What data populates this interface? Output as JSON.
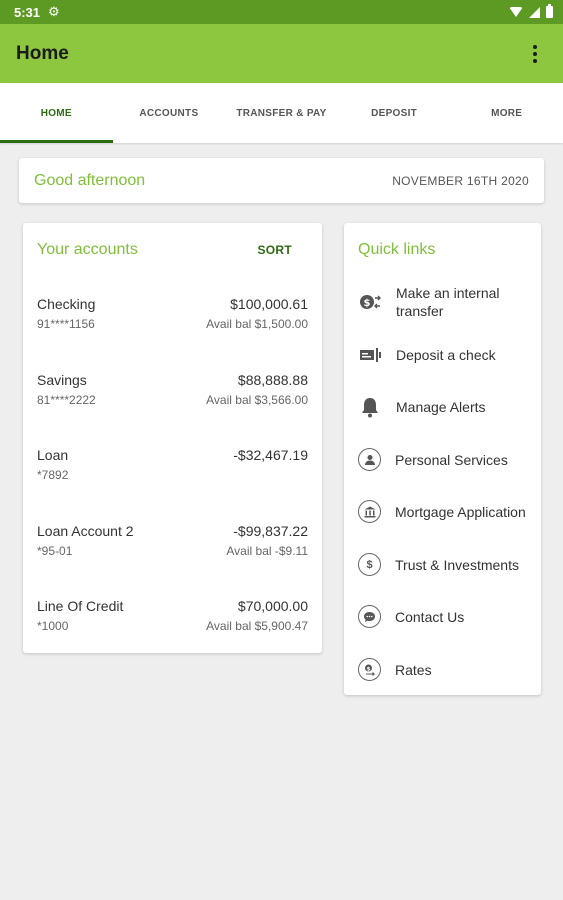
{
  "status_bar": {
    "time": "5:31"
  },
  "app_bar": {
    "title": "Home"
  },
  "tabs": [
    {
      "label": "HOME"
    },
    {
      "label": "ACCOUNTS"
    },
    {
      "label": "TRANSFER & PAY"
    },
    {
      "label": "DEPOSIT"
    },
    {
      "label": "MORE"
    }
  ],
  "greeting": {
    "text": "Good afternoon",
    "date": "NOVEMBER 16TH 2020"
  },
  "accounts": {
    "title": "Your accounts",
    "sort_label": "SORT",
    "items": [
      {
        "name": "Checking",
        "number": "91****1156",
        "amount": "$100,000.61",
        "avail": "Avail bal $1,500.00"
      },
      {
        "name": "Savings",
        "number": "81****2222",
        "amount": "$88,888.88",
        "avail": "Avail bal $3,566.00"
      },
      {
        "name": "Loan",
        "number": "*7892",
        "amount": "-$32,467.19",
        "avail": ""
      },
      {
        "name": "Loan Account 2",
        "number": "*95-01",
        "amount": "-$99,837.22",
        "avail": "Avail bal -$9.11"
      },
      {
        "name": "Line Of Credit",
        "number": "*1000",
        "amount": "$70,000.00",
        "avail": "Avail bal $5,900.47"
      }
    ]
  },
  "quick_links": {
    "title": "Quick links",
    "items": [
      {
        "label_line1": "Make an internal",
        "label_line2": "transfer",
        "icon": "transfer-icon"
      },
      {
        "label_line1": "Deposit a check",
        "icon": "check-deposit-icon"
      },
      {
        "label_line1": "Manage Alerts",
        "icon": "bell-icon"
      },
      {
        "label_line1": "Personal Services",
        "icon": "person-icon"
      },
      {
        "label_line1": "Mortgage Application",
        "icon": "bank-icon"
      },
      {
        "label_line1": "Trust & Investments",
        "icon": "dollar-icon"
      },
      {
        "label_line1": "Contact Us",
        "icon": "chat-icon"
      },
      {
        "label_line1": "Rates",
        "icon": "rates-icon"
      }
    ]
  },
  "colors": {
    "status_bar": "#5c9a23",
    "app_bar": "#8dc63f",
    "accent_green": "#7fbf3a",
    "tab_active": "#2e6b12"
  }
}
